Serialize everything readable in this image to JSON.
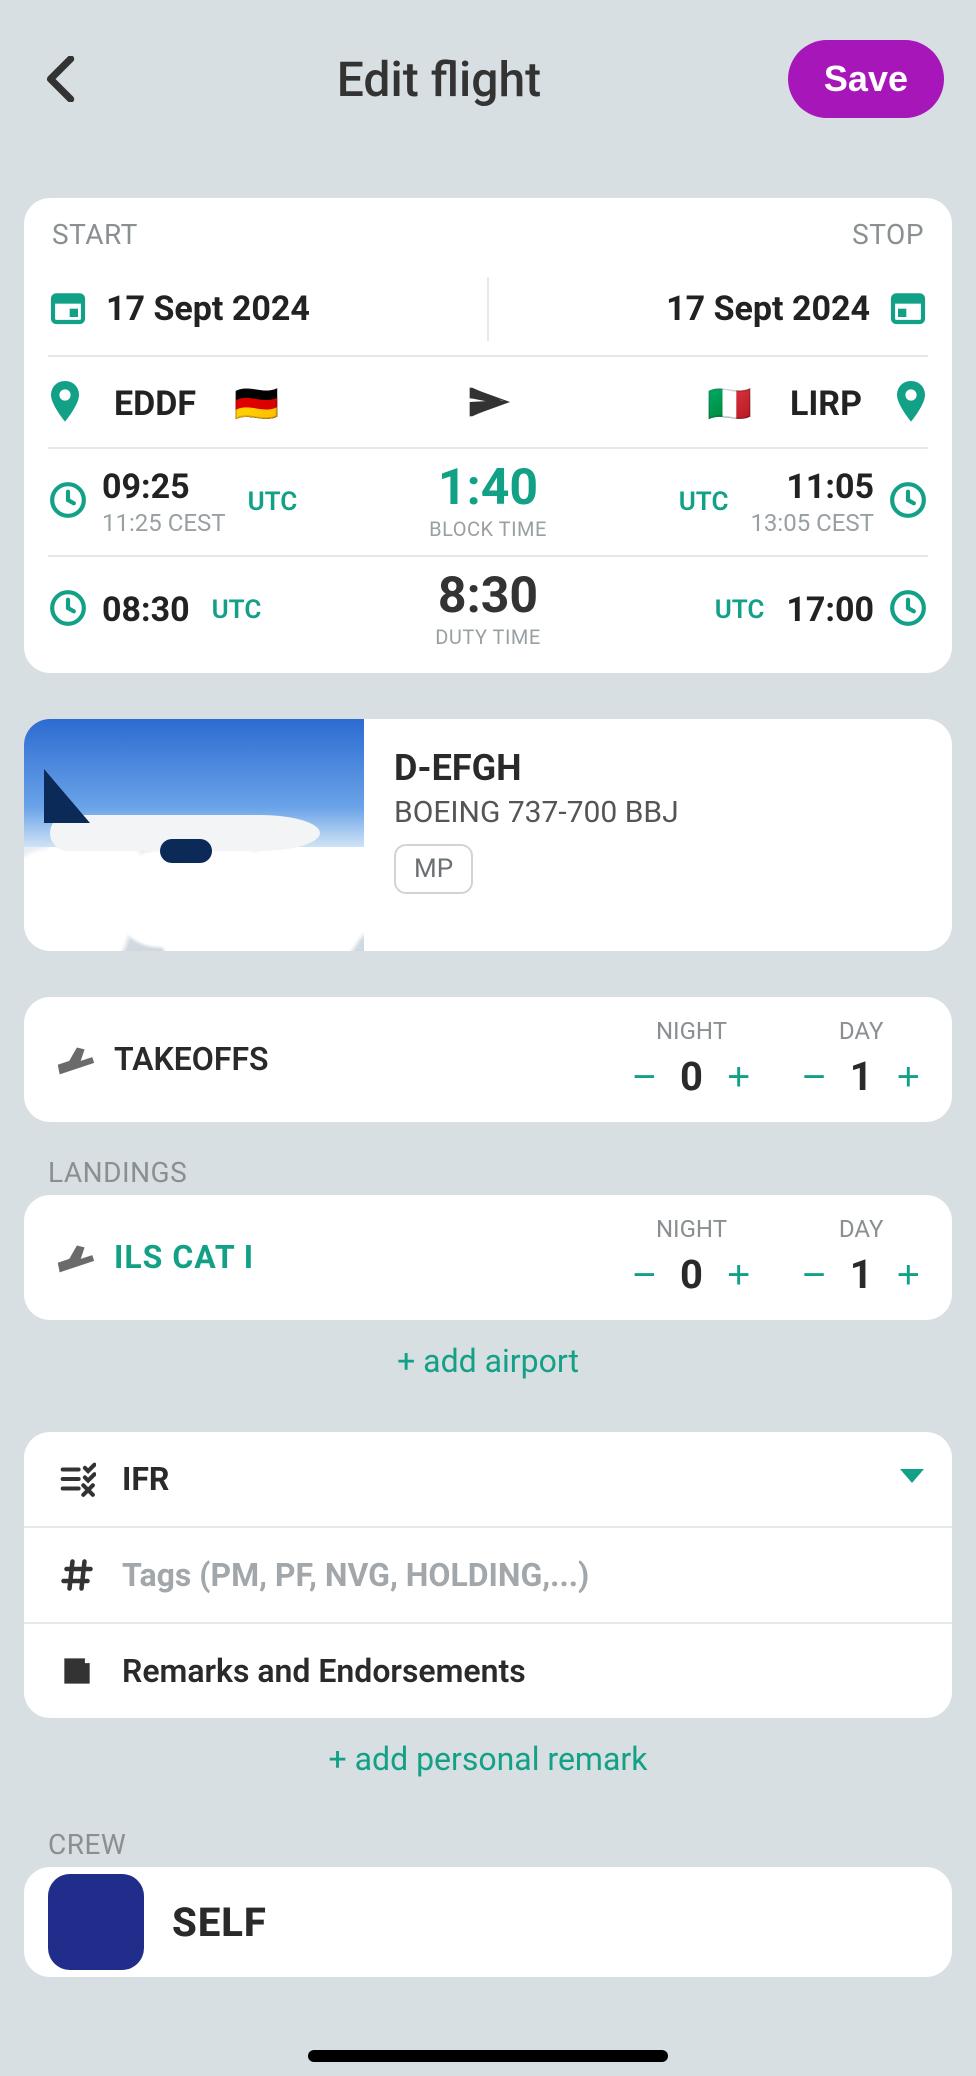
{
  "header": {
    "title": "Edit flight",
    "save": "Save"
  },
  "labels": {
    "start": "START",
    "stop": "STOP",
    "block_time": "BLOCK TIME",
    "duty_time": "DUTY TIME",
    "utc": "UTC",
    "night": "NIGHT",
    "day": "DAY",
    "takeoffs": "TAKEOFFS",
    "landings": "LANDINGS",
    "crew": "CREW"
  },
  "dates": {
    "start": "17 Sept 2024",
    "stop": "17 Sept 2024"
  },
  "airports": {
    "dep": {
      "code": "EDDF",
      "flag": "🇩🇪"
    },
    "arr": {
      "code": "LIRP",
      "flag": "🇮🇹"
    }
  },
  "block": {
    "out": {
      "main": "09:25",
      "sub": "11:25 CEST"
    },
    "in": {
      "main": "11:05",
      "sub": "13:05 CEST"
    },
    "dur": "1:40"
  },
  "duty": {
    "on": "08:30",
    "off": "17:00",
    "dur": "8:30"
  },
  "aircraft": {
    "reg": "D-EFGH",
    "type": "BOEING 737-700 BBJ",
    "tag": "MP"
  },
  "takeoffs": {
    "night": 0,
    "day": 1
  },
  "landing": {
    "approach": "ILS CAT I",
    "night": 0,
    "day": 1
  },
  "links": {
    "add_airport": "+ add airport",
    "add_remark": "+ add personal remark"
  },
  "rules": {
    "value": "IFR"
  },
  "tags_placeholder": "Tags (PM, PF, NVG, HOLDING,...)",
  "remarks_label": "Remarks and Endorsements",
  "crew": {
    "self": "SELF"
  }
}
